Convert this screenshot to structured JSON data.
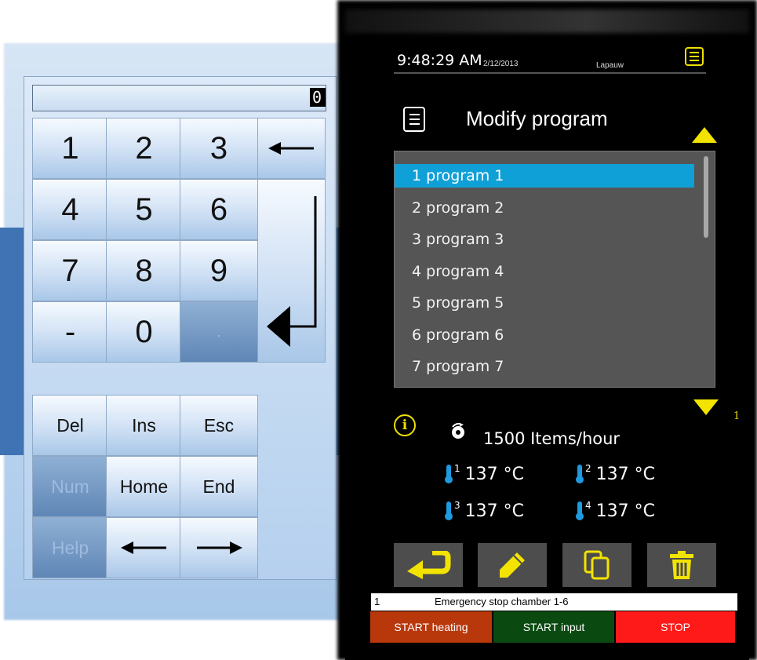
{
  "keypad": {
    "display_value": "0",
    "digits": [
      "1",
      "2",
      "3",
      "4",
      "5",
      "6",
      "7",
      "8",
      "9",
      "-",
      "0",
      "."
    ],
    "functions": {
      "del": "Del",
      "ins": "Ins",
      "esc": "Esc",
      "num": "Num",
      "home": "Home",
      "end": "End",
      "help": "Help"
    }
  },
  "header": {
    "time": "9:48:29 AM",
    "date": "2/12/2013",
    "user": "Lapauw"
  },
  "page": {
    "title": "Modify program"
  },
  "programs": {
    "items": [
      "1 program 1",
      "2 program 2",
      "3 program 3",
      "4 program 4",
      "5 program 5",
      "6 program 6",
      "7 program 7"
    ],
    "selected_index": 0,
    "marker": "1"
  },
  "status": {
    "speed": "1500 Items/hour",
    "temps": [
      {
        "index": "1",
        "value": "137 °C"
      },
      {
        "index": "2",
        "value": "137 °C"
      },
      {
        "index": "3",
        "value": "137 °C"
      },
      {
        "index": "4",
        "value": "137 °C"
      }
    ]
  },
  "alarm": {
    "number": "1",
    "text": "Emergency stop chamber 1-6"
  },
  "commands": {
    "start_heating": "START heating",
    "start_input": "START input",
    "stop": "STOP"
  },
  "colors": {
    "accent_yellow": "#f2e400",
    "selection_blue": "#10a0d8",
    "start_heating": "#b8380c",
    "start_input": "#0a4a10",
    "stop": "#ff1a1a"
  },
  "icons": {
    "actions": [
      "return-icon",
      "edit-icon",
      "copy-icon",
      "delete-icon"
    ]
  }
}
